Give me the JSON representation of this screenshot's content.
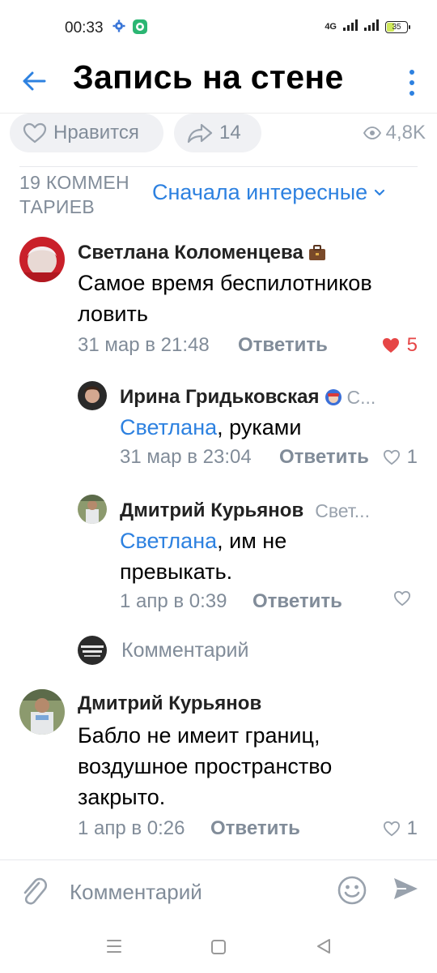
{
  "status": {
    "time": "00:33",
    "network": "4G",
    "battery": "35",
    "battery_level": 0.35
  },
  "header": {
    "title": "Запись на стене"
  },
  "actions": {
    "like_label": "Нравится",
    "share_count": "14",
    "views": "4,8K"
  },
  "comments_header": {
    "count": "19 КОММЕНТАРИЕВ",
    "sort": "Сначала интересные"
  },
  "comments": [
    {
      "name": "Светлана Коломенцева",
      "badge": "briefcase-icon",
      "text": "Самое время беспилотников ловить",
      "time": "31 мар в 21:48",
      "reply": "Ответить",
      "likes": "5",
      "liked": true
    },
    {
      "name": "Ирина Гридьковская",
      "reply_to": "С...",
      "mention": "Светлана",
      "text": ", руками",
      "time": "31 мар в 23:04",
      "reply": "Ответить",
      "likes": "1",
      "liked": false
    },
    {
      "name": "Дмитрий Курьянов",
      "reply_to": "Свет...",
      "mention": "Светлана",
      "text": ", им не превыкать.",
      "time": "1 апр в 0:39",
      "reply": "Ответить",
      "likes": "",
      "liked": false
    },
    {
      "name": "Дмитрий Курьянов",
      "text": "Бабло не имеит границ, воздушное пространство закрыто.",
      "time": "1 апр в 0:26",
      "reply": "Ответить",
      "likes": "1",
      "liked": false
    }
  ],
  "reply_box": {
    "placeholder": "Комментарий"
  },
  "composer": {
    "placeholder": "Комментарий"
  },
  "colors": {
    "accent": "#2d81e0",
    "secondary": "#818c99",
    "like": "#e64646"
  }
}
